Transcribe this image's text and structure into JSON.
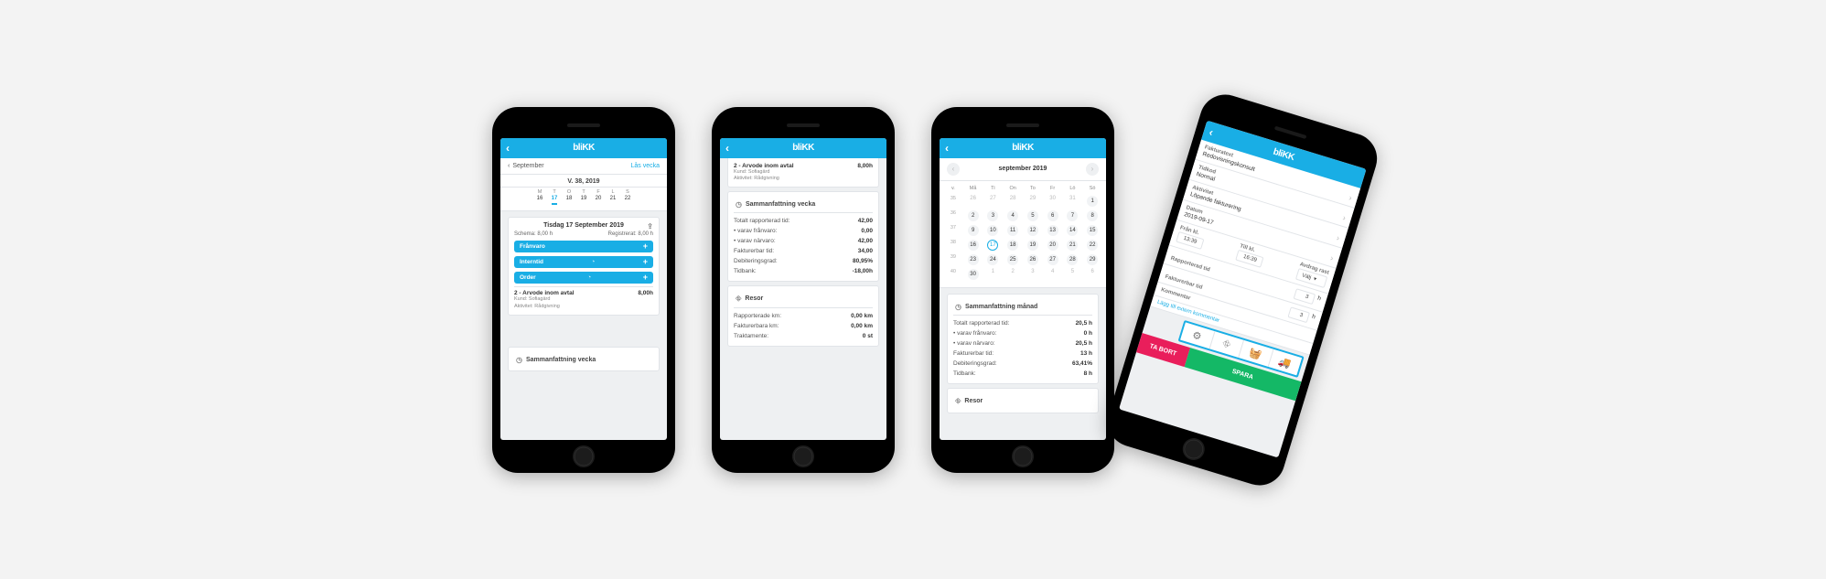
{
  "brand": "bliKK",
  "phone1": {
    "subhdr_left": "September",
    "subhdr_right": "Lås vecka",
    "week_label": "V. 38, 2019",
    "days": [
      {
        "lbl": "M",
        "num": "16"
      },
      {
        "lbl": "T",
        "num": "17",
        "sel": true
      },
      {
        "lbl": "O",
        "num": "18"
      },
      {
        "lbl": "T",
        "num": "19"
      },
      {
        "lbl": "F",
        "num": "20"
      },
      {
        "lbl": "L",
        "num": "21"
      },
      {
        "lbl": "S",
        "num": "22"
      }
    ],
    "date_title": "Tisdag 17 September 2019",
    "schema": "Schema: 8,00 h",
    "reg": "Registrerat: 8,00 h",
    "pills": [
      {
        "label": "Frånvaro"
      },
      {
        "label": "Interntid"
      },
      {
        "label": "Order"
      }
    ],
    "entry": {
      "title": "2 - Arvode inom avtal",
      "hours": "8,00h",
      "line1": "Kund: Sofiagärd",
      "line2": "Aktivitet: Rådgivning"
    },
    "bottom_label": "Sammanfattning vecka"
  },
  "phone2": {
    "entry": {
      "title": "2 - Arvode inom avtal",
      "hours": "8,00h",
      "line1": "Kund: Sofiagärd",
      "line2": "Aktivitet: Rådgivning"
    },
    "summary_label": "Sammanfattning vecka",
    "rows": [
      {
        "lbl": "Totalt rapporterad tid:",
        "val": "42,00"
      },
      {
        "lbl": "• varav frånvaro:",
        "val": "0,00"
      },
      {
        "lbl": "• varav närvaro:",
        "val": "42,00"
      },
      {
        "lbl": "Fakturerbar tid:",
        "val": "34,00"
      },
      {
        "lbl": "Debiteringsgrad:",
        "val": "80,95%"
      },
      {
        "lbl": "Tidbank:",
        "val": "-18,00h"
      }
    ],
    "travel_label": "Resor",
    "travel_rows": [
      {
        "lbl": "Rapporterade km:",
        "val": "0,00 km"
      },
      {
        "lbl": "Fakturerbara km:",
        "val": "0,00 km"
      },
      {
        "lbl": "Traktamente:",
        "val": "0 st"
      }
    ]
  },
  "phone3": {
    "month_title": "september 2019",
    "dayhdr": [
      "v.",
      "Må",
      "Ti",
      "On",
      "To",
      "Fr",
      "Lö",
      "Sö"
    ],
    "weeks": [
      {
        "wk": "35",
        "days": [
          "26",
          "27",
          "28",
          "29",
          "30",
          "31",
          "1"
        ],
        "out": 6
      },
      {
        "wk": "36",
        "days": [
          "2",
          "3",
          "4",
          "5",
          "6",
          "7",
          "8"
        ]
      },
      {
        "wk": "37",
        "days": [
          "9",
          "10",
          "11",
          "12",
          "13",
          "14",
          "15"
        ]
      },
      {
        "wk": "38",
        "days": [
          "16",
          "17",
          "18",
          "19",
          "20",
          "21",
          "22"
        ],
        "sel": 1
      },
      {
        "wk": "39",
        "days": [
          "23",
          "24",
          "25",
          "26",
          "27",
          "28",
          "29"
        ]
      },
      {
        "wk": "40",
        "days": [
          "30",
          "1",
          "2",
          "3",
          "4",
          "5",
          "6"
        ],
        "outFrom": 1
      }
    ],
    "summary_label": "Sammanfattning månad",
    "rows": [
      {
        "lbl": "Totalt rapporterad tid:",
        "val": "20,5 h"
      },
      {
        "lbl": "• varav frånvaro:",
        "val": "0 h"
      },
      {
        "lbl": "• varav närvaro:",
        "val": "20,5 h"
      },
      {
        "lbl": "Fakturerbar tid:",
        "val": "13 h"
      },
      {
        "lbl": "Debiteringsgrad:",
        "val": "63,41%"
      },
      {
        "lbl": "Tidbank:",
        "val": "8 h"
      }
    ],
    "travel_label": "Resor"
  },
  "phone4": {
    "top_label": "Fakturatext",
    "top_value": "Redovisningskonsult",
    "groups": [
      {
        "label": "Tidkod",
        "value": "Normal"
      },
      {
        "label": "Aktivitet",
        "value": "Löpande fakturering"
      },
      {
        "label": "Datum",
        "value": "2019-09-17"
      }
    ],
    "from_label": "Från kl.",
    "from_value": "13:39",
    "to_label": "Till kl.",
    "to_value": "16:39",
    "deduct_label": "Avdrag rast",
    "deduct_value": "Välj",
    "reported_label": "Rapporterad tid",
    "reported_val": "3",
    "reported_unit": "h",
    "billable_label": "Fakturerbar tid",
    "billable_val": "3",
    "billable_unit": "h",
    "comment_label": "Kommentar",
    "link": "Lägg till extern kommentar",
    "delete": "TA BORT",
    "save": "SPARA"
  }
}
